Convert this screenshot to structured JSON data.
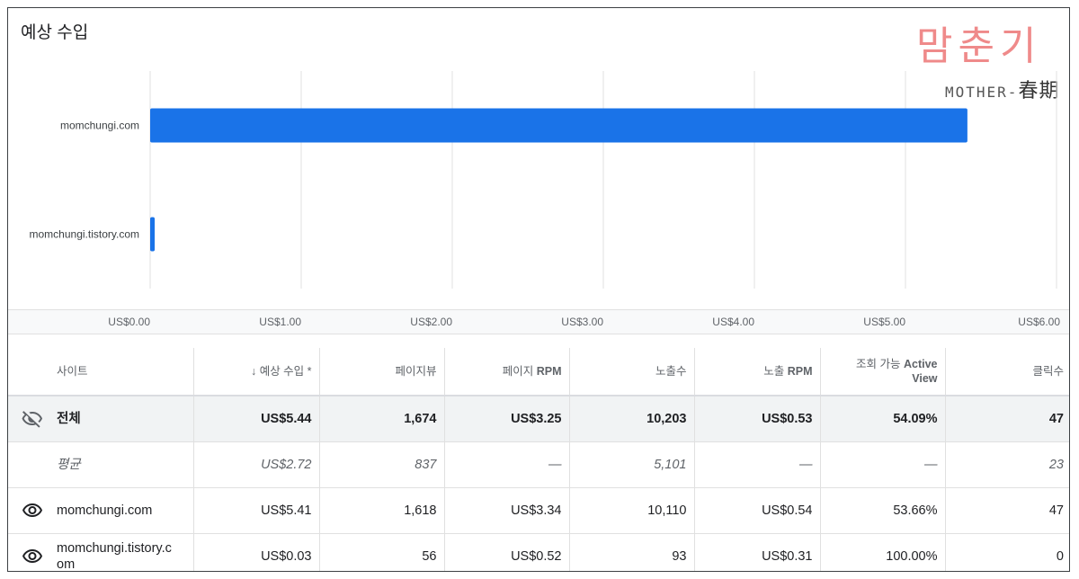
{
  "card": {
    "title": "예상 수입"
  },
  "logo": {
    "main": "맘춘기",
    "sub_latin": "MOTHER-",
    "sub_han": "春期"
  },
  "chart_data": {
    "type": "bar",
    "orientation": "horizontal",
    "categories": [
      "momchungi.com",
      "momchungi.tistory.com"
    ],
    "values": [
      5.41,
      0.03
    ],
    "xlim": [
      0,
      6
    ],
    "ticks": [
      "US$0.00",
      "US$1.00",
      "US$2.00",
      "US$3.00",
      "US$4.00",
      "US$5.00",
      "US$6.00"
    ],
    "grid": true,
    "bar_color": "#1a73e8"
  },
  "table": {
    "headers": {
      "site": "사이트",
      "revenue": "예상 수입 *",
      "pageviews": "페이지뷰",
      "page_rpm_ko": "페이지 ",
      "page_rpm_en": "RPM",
      "impressions": "노출수",
      "imp_rpm_ko": "노출 ",
      "imp_rpm_en": "RPM",
      "active_view_ko": "조회 가능 ",
      "active_view_en1": "Active",
      "active_view_en2": "View",
      "clicks": "클릭수"
    },
    "total": {
      "site": "전체",
      "revenue": "US$5.44",
      "pageviews": "1,674",
      "page_rpm": "US$3.25",
      "impressions": "10,203",
      "imp_rpm": "US$0.53",
      "active_view": "54.09%",
      "clicks": "47"
    },
    "average": {
      "site": "평균",
      "revenue": "US$2.72",
      "pageviews": "837",
      "page_rpm": "—",
      "impressions": "5,101",
      "imp_rpm": "—",
      "active_view": "—",
      "clicks": "23"
    },
    "rows": [
      {
        "site": "momchungi.com",
        "revenue": "US$5.41",
        "pageviews": "1,618",
        "page_rpm": "US$3.34",
        "impressions": "10,110",
        "imp_rpm": "US$0.54",
        "active_view": "53.66%",
        "clicks": "47"
      },
      {
        "site": "momchungi.tistory.c om",
        "revenue": "US$0.03",
        "pageviews": "56",
        "page_rpm": "US$0.52",
        "impressions": "93",
        "imp_rpm": "US$0.31",
        "active_view": "100.00%",
        "clicks": "0"
      }
    ]
  }
}
